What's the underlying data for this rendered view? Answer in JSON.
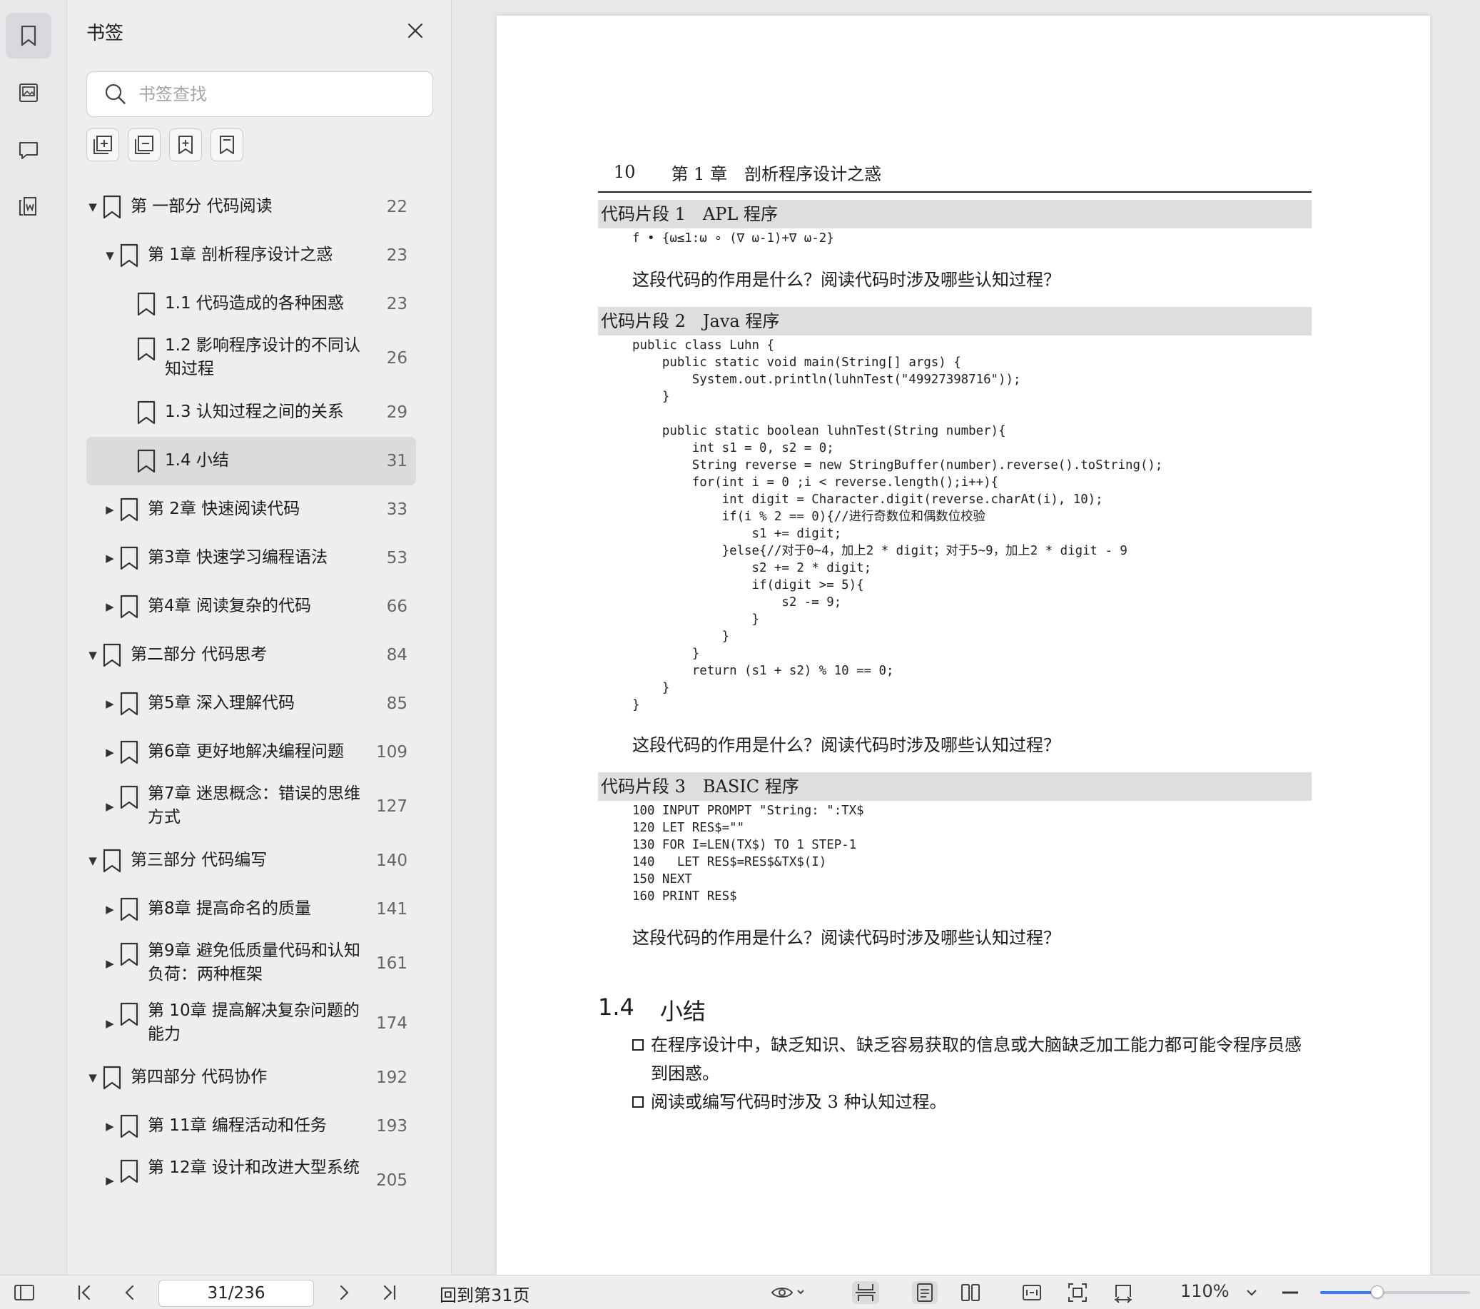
{
  "sidebar_panel": {
    "title": "书签",
    "search_placeholder": "书签查找",
    "tool_icons": [
      "expand-all-icon",
      "collapse-all-icon",
      "add-bookmark-icon",
      "bookmark-icon"
    ],
    "items": [
      {
        "label": "第 一部分 代码阅读",
        "page": "22",
        "level": 0,
        "caret": "expanded"
      },
      {
        "label": "第 1章 剖析程序设计之惑",
        "page": "23",
        "level": 1,
        "caret": "expanded"
      },
      {
        "label": "1.1 代码造成的各种困惑",
        "page": "23",
        "level": 2,
        "caret": "none"
      },
      {
        "label": "1.2 影响程序设计的不同认知过程",
        "page": "26",
        "level": 2,
        "caret": "none"
      },
      {
        "label": "1.3 认知过程之间的关系",
        "page": "29",
        "level": 2,
        "caret": "none"
      },
      {
        "label": "1.4 小结",
        "page": "31",
        "level": 2,
        "caret": "none",
        "selected": true
      },
      {
        "label": "第 2章 快速阅读代码",
        "page": "33",
        "level": 1,
        "caret": "collapsed"
      },
      {
        "label": "第3章 快速学习编程语法",
        "page": "53",
        "level": 1,
        "caret": "collapsed"
      },
      {
        "label": "第4章 阅读复杂的代码",
        "page": "66",
        "level": 1,
        "caret": "collapsed"
      },
      {
        "label": "第二部分 代码思考",
        "page": "84",
        "level": 0,
        "caret": "expanded"
      },
      {
        "label": "第5章 深入理解代码",
        "page": "85",
        "level": 1,
        "caret": "collapsed"
      },
      {
        "label": "第6章 更好地解决编程问题",
        "page": "109",
        "level": 1,
        "caret": "collapsed"
      },
      {
        "label": "第7章 迷思概念：错误的思维方式",
        "page": "127",
        "level": 1,
        "caret": "collapsed"
      },
      {
        "label": "第三部分 代码编写",
        "page": "140",
        "level": 0,
        "caret": "expanded"
      },
      {
        "label": "第8章 提高命名的质量",
        "page": "141",
        "level": 1,
        "caret": "collapsed"
      },
      {
        "label": "第9章 避免低质量代码和认知负荷：两种框架",
        "page": "161",
        "level": 1,
        "caret": "collapsed"
      },
      {
        "label": "第 10章 提高解决复杂问题的能力",
        "page": "174",
        "level": 1,
        "caret": "collapsed"
      },
      {
        "label": "第四部分 代码协作",
        "page": "192",
        "level": 0,
        "caret": "expanded"
      },
      {
        "label": "第 11章 编程活动和任务",
        "page": "193",
        "level": 1,
        "caret": "collapsed"
      },
      {
        "label": "第 12章 设计和改进大型系统",
        "page": "205",
        "level": 1,
        "caret": "collapsed"
      }
    ]
  },
  "document": {
    "page_number": "10",
    "running_title": "第 1 章　剖析程序设计之惑",
    "snippets": [
      {
        "title": "代码片段 1　APL 程序",
        "code": "f • {ω≤1:ω ∘ (∇ ω-1)+∇ ω-2}",
        "question": "这段代码的作用是什么？阅读代码时涉及哪些认知过程？"
      },
      {
        "title": "代码片段 2　Java 程序",
        "code": "public class Luhn {\n    public static void main(String[] args) {\n        System.out.println(luhnTest(\"49927398716\"));\n    }\n\n    public static boolean luhnTest(String number){\n        int s1 = 0, s2 = 0;\n        String reverse = new StringBuffer(number).reverse().toString();\n        for(int i = 0 ;i < reverse.length();i++){\n            int digit = Character.digit(reverse.charAt(i), 10);\n            if(i % 2 == 0){//进行奇数位和偶数位校验\n                s1 += digit;\n            }else{//对于0~4，加上2 * digit；对于5~9，加上2 * digit - 9\n                s2 += 2 * digit;\n                if(digit >= 5){\n                    s2 -= 9;\n                }\n            }\n        }\n        return (s1 + s2) % 10 == 0;\n    }\n}",
        "question": "这段代码的作用是什么？阅读代码时涉及哪些认知过程？"
      },
      {
        "title": "代码片段 3　BASIC 程序",
        "code": "100 INPUT PROMPT \"String: \":TX$\n120 LET RES$=\"\"\n130 FOR I=LEN(TX$) TO 1 STEP-1\n140   LET RES$=RES$&TX$(I)\n150 NEXT\n160 PRINT RES$",
        "question": "这段代码的作用是什么？阅读代码时涉及哪些认知过程？"
      }
    ],
    "section": {
      "number": "1.4",
      "title": "小结"
    },
    "summary": [
      "在程序设计中，缺乏知识、缺乏容易获取的信息或大脑缺乏加工能力都可能令程序员感到困惑。",
      "阅读或编写代码时涉及 3 种认知过程。"
    ]
  },
  "bottom_bar": {
    "page_indicator": "31/236",
    "back_to_page": "回到第31页",
    "zoom": "110%",
    "zoom_level": 0.38
  },
  "colors": {
    "accent": "#3b7cf6",
    "panel_bg": "#efedf0",
    "selected_bg": "#dcdadd"
  }
}
